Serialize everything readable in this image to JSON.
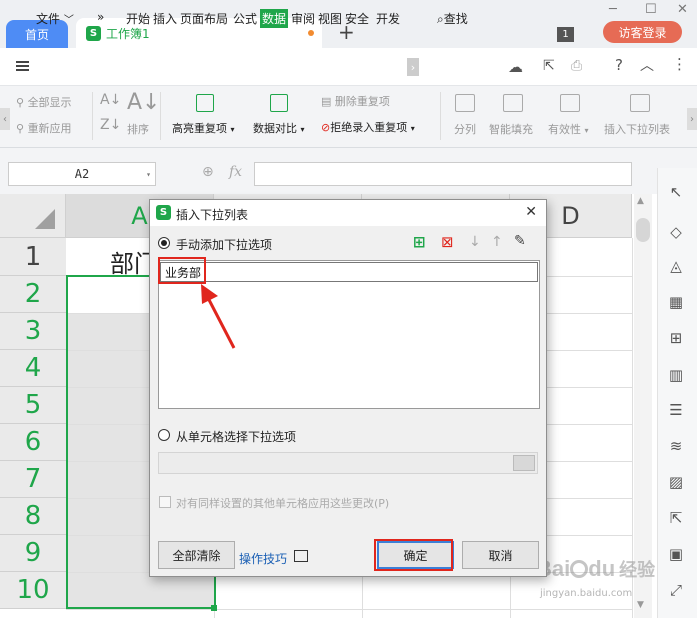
{
  "titlebar": {
    "home_tab": "首页",
    "doc_logo": "S",
    "doc_tab": "工作簿1",
    "new_tab_symbol": "+",
    "badge": "1",
    "login": "访客登录"
  },
  "menubar": {
    "file": "文件",
    "more": "»",
    "items": [
      "开始",
      "插入",
      "页面布局",
      "公式",
      "数据",
      "审阅",
      "视图",
      "安全",
      "开发"
    ],
    "active": "数据",
    "search": "查找"
  },
  "ribbon": {
    "show_all": "全部显示",
    "reapply": "重新应用",
    "sort": "排序",
    "highlight_dup": "高亮重复项",
    "data_compare": "数据对比",
    "remove_dup": "删除重复项",
    "reject_dup": "拒绝录入重复项",
    "split": "分列",
    "smart_fill": "智能填充",
    "validity": "有效性",
    "insert_dropdown": "插入下拉列表"
  },
  "formula_bar": {
    "cell_ref": "A2",
    "fx": "fx",
    "value": ""
  },
  "sheet": {
    "columns": [
      "A",
      "D"
    ],
    "rows": [
      "1",
      "2",
      "3",
      "4",
      "5",
      "6",
      "7",
      "8",
      "9",
      "10"
    ],
    "cell_a1": "部门"
  },
  "dialog": {
    "title": "插入下拉列表",
    "logo": "S",
    "option_manual": "手动添加下拉选项",
    "list_items": [
      "业务部"
    ],
    "option_from_cells": "从单元格选择下拉选项",
    "apply_same": "对有同样设置的其他单元格应用这些更改(P)",
    "clear_all": "全部清除",
    "tips": "操作技巧",
    "ok": "确定",
    "cancel": "取消"
  },
  "watermark": {
    "brand": "Bai",
    "brand2": "du",
    "suffix": "经验",
    "url": "jingyan.baidu.com"
  },
  "colors": {
    "accent_green": "#1fa64a",
    "home_blue": "#4e8cf5",
    "login_red": "#e66b55",
    "highlight_red": "#e0261d"
  }
}
